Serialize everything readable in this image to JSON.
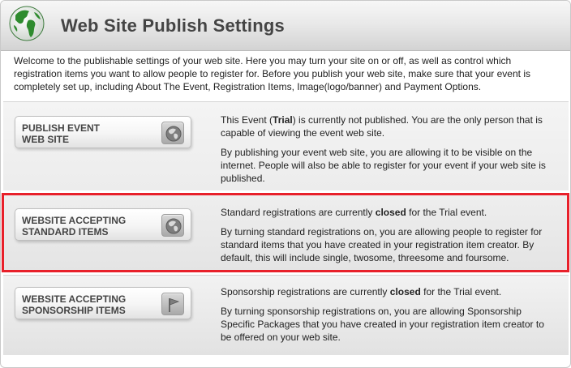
{
  "header": {
    "title": "Web Site Publish Settings",
    "icon": "globe-icon"
  },
  "intro": "Welcome to the publishable settings of your web site. Here you may turn your site on or off, as well as control which registration items you want to allow people to register for. Before you publish your web site, make sure that your event is completely set up, including About The Event, Registration Items, Image(logo/banner) and Payment Options.",
  "sections": [
    {
      "button_label": "PUBLISH  EVENT\nWEB SITE",
      "button_icon": "globe-icon",
      "status_pre": "This Event (",
      "status_bold": "Trial",
      "status_post": ") is currently not published. You are the only person that is capable of viewing the event web site.",
      "detail": "By publishing your event web site, you are allowing it to be visible on the internet. People will also be able to register for your event if your web site is published."
    },
    {
      "button_label": "WEBSITE ACCEPTING\nSTANDARD ITEMS",
      "button_icon": "globe-icon",
      "status_pre": "Standard registrations are currently ",
      "status_bold": "closed",
      "status_post": " for the Trial event.",
      "detail": "By turning standard registrations on, you are allowing people to register for standard items that you have created in your registration item creator. By default, this will include single, twosome, threesome and foursome."
    },
    {
      "button_label": "WEBSITE ACCEPTING\nSPONSORSHIP ITEMS",
      "button_icon": "flag-icon",
      "status_pre": "Sponsorship registrations are currently ",
      "status_bold": "closed",
      "status_post": " for the Trial event.",
      "detail": "By turning sponsorship registrations on, you are allowing Sponsorship Specific Packages that you have created in your registration item creator to be offered on your web site."
    }
  ],
  "colors": {
    "highlight": "#e8202a",
    "globe_green": "#2e8b2e"
  }
}
